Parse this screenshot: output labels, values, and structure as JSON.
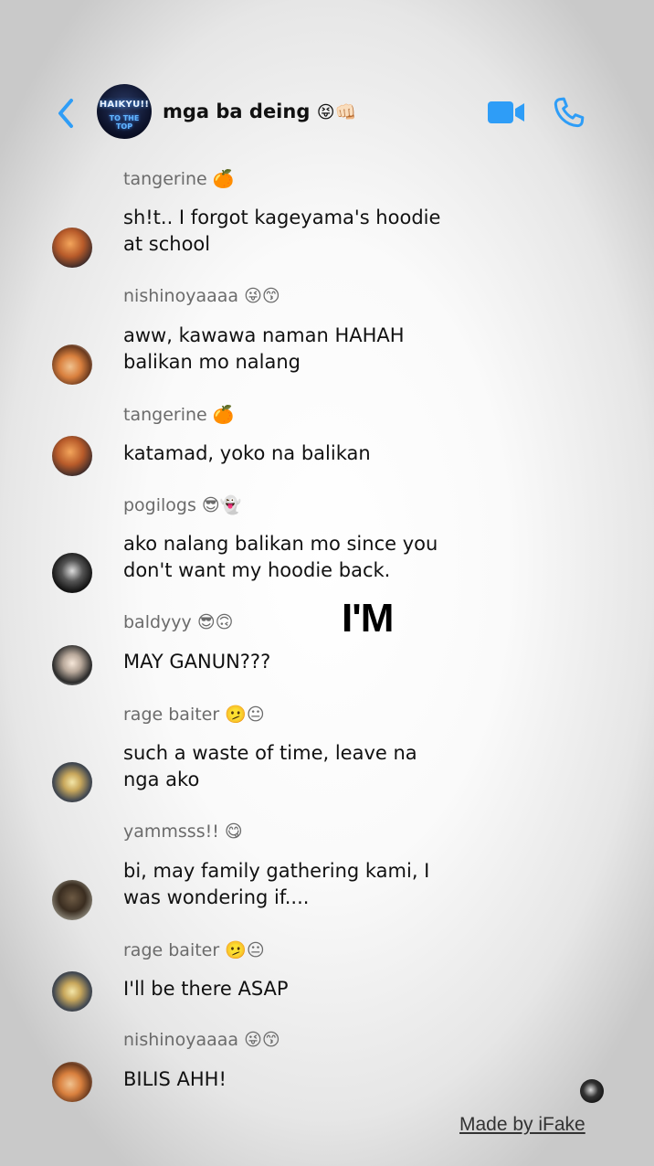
{
  "header": {
    "title": "mga ba deing",
    "title_emoji": "😝👊🏻",
    "avatar_text": "HAIKYU!!",
    "avatar_subtext": "TO THE TOP",
    "back_icon": "chevron-left-icon",
    "video_icon": "video-camera-icon",
    "call_icon": "phone-icon",
    "accent_color": "#2e9df7"
  },
  "messages": [
    {
      "sender": "tangerine 🍊",
      "text": "sh!t.. I forgot kageyama's hoodie\nat school"
    },
    {
      "sender": "nishinoyaaaa 😜😙",
      "text": "aww, kawawa naman HAHAH\nbalikan mo nalang"
    },
    {
      "sender": "tangerine 🍊",
      "text": "katamad, yoko na balikan"
    },
    {
      "sender": "pogilogs 😎👻",
      "text": "ako nalang balikan mo since you\ndon't want my hoodie back."
    },
    {
      "sender": "baldyyy 😎🙃",
      "text": "MAY GANUN???"
    },
    {
      "sender": "rage baiter 🫤😐",
      "text": "such a waste of time, leave na\nnga ako"
    },
    {
      "sender": "yammsss!! 😋",
      "text": "bi, may family gathering kami, I\nwas wondering if...."
    },
    {
      "sender": "rage baiter 🫤😐",
      "text": "I'll be there ASAP"
    },
    {
      "sender": "nishinoyaaaa 😜😙",
      "text": "BILIS AHH!"
    }
  ],
  "overlay": {
    "text": "I'M"
  },
  "watermark": {
    "text": "Made by iFake"
  }
}
